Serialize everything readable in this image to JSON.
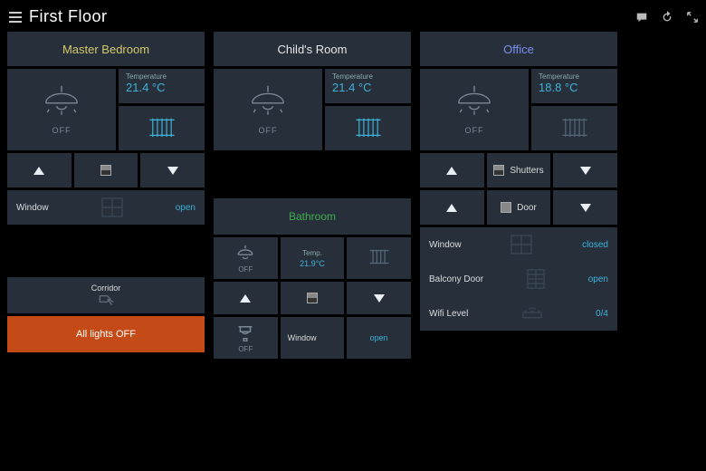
{
  "header": {
    "title": "First Floor"
  },
  "rooms": {
    "master": {
      "title": "Master Bedroom",
      "title_color": "#d5c96a",
      "light": "OFF",
      "temp_label": "Temperature",
      "temp_value": "21.4 °C",
      "window_label": "Window",
      "window_state": "open"
    },
    "child": {
      "title": "Child's Room",
      "title_color": "#e8e8e8",
      "light": "OFF",
      "temp_label": "Temperature",
      "temp_value": "21.4 °C"
    },
    "office": {
      "title": "Office",
      "title_color": "#7a8ef0",
      "light": "OFF",
      "temp_label": "Temperature",
      "temp_value": "18.8 °C",
      "shutters_label": "Shutters",
      "door_label": "Door",
      "window_label": "Window",
      "window_state": "closed",
      "balcony_label": "Balcony Door",
      "balcony_state": "open",
      "wifi_label": "Wifi Level",
      "wifi_value": "0/4"
    },
    "bathroom": {
      "title": "Bathroom",
      "title_color": "#3fae4f",
      "light": "OFF",
      "temp_label": "Temp.",
      "temp_value": "21.9°C",
      "window_label": "Window",
      "window_state": "open"
    }
  },
  "corridor": {
    "label": "Corridor",
    "all_off": "All lights OFF"
  }
}
